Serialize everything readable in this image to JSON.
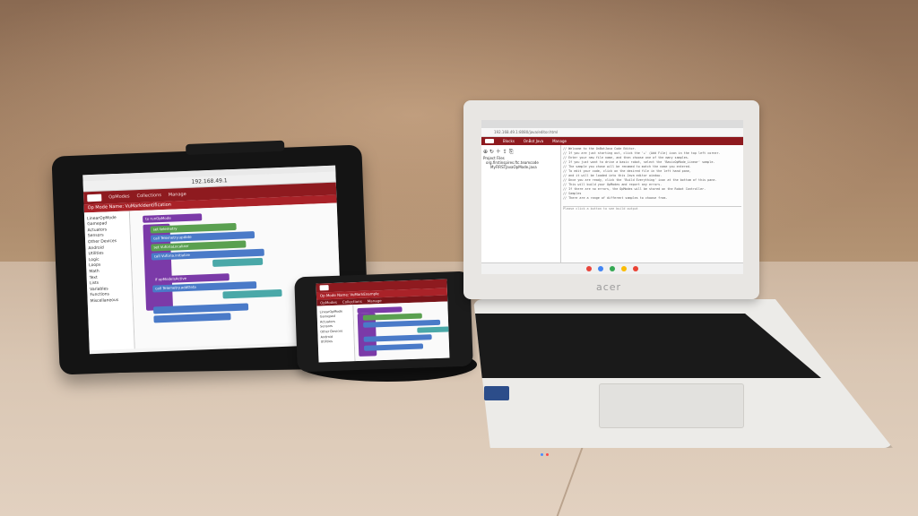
{
  "tablet": {
    "address": "192.168.49.1",
    "tabs": [
      "OpModes",
      "Collections",
      "Manage"
    ],
    "opmode_title": "Op Mode Name: VuMarkIdentification",
    "toolbox": [
      "LinearOpMode",
      "Gamepad",
      "Actuators",
      "Sensors",
      "Other Devices",
      "Android",
      "Utilities",
      "Logic",
      "Loops",
      "Math",
      "Text",
      "Lists",
      "Variables",
      "Functions",
      "Miscellaneous"
    ],
    "blocks": [
      "to runOpMode",
      "set telemetry",
      "call Telemetry.update",
      "set VuforiaLocalizer",
      "call Vuforia.initialize",
      "if opModeIsActive",
      "call Telemetry.addData"
    ]
  },
  "phone": {
    "title": "Op Mode Name: VuMarkExample",
    "tabs": [
      "OpModes",
      "Collections",
      "Manage"
    ],
    "toolbox": [
      "LinearOpMode",
      "Gamepad",
      "Actuators",
      "Sensors",
      "Other Devices",
      "Android",
      "Utilities"
    ]
  },
  "laptop": {
    "url": "192.168.49.1:8080/java/editor.html",
    "tabs": [
      "Blocks",
      "OnBot Java",
      "Manage"
    ],
    "project_label": "Project Files",
    "files": [
      "org.firstinspires.ftc.teamcode",
      "MyFIRSTJavaOpMode.java"
    ],
    "editor_lines": [
      "// Welcome to the OnBotJava Code Editor.",
      "// If you are just starting out, click the '+' (Add File) icon in the top left corner.",
      "// Enter your new file name, and then choose one of the many samples.",
      "// If you just want to drive a basic robot, select the 'BasicOpMode_Linear' sample.",
      "// The sample you chose will be renamed to match the name you entered.",
      "// To edit your code, click on the desired file in the left hand pane,",
      "// and it will be loaded into this Java editor window.",
      "// Once you are ready, click the 'Build Everything' icon at the bottom of this pane.",
      "// This will build your OpModes and report any errors.",
      "// If there are no errors, the OpModes will be stored on the Robot Controller.",
      "// Samples",
      "// There are a range of different samples to choose from."
    ],
    "status": "Please click a button to see build output",
    "brand": "acer"
  }
}
